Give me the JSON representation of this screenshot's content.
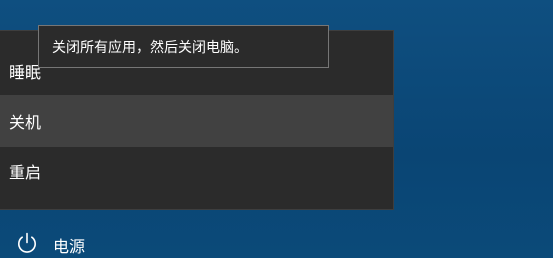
{
  "tooltip": {
    "text": "关闭所有应用，然后关闭电脑。"
  },
  "power_menu": {
    "items": [
      {
        "label": "睡眠"
      },
      {
        "label": "关机"
      },
      {
        "label": "重启"
      }
    ]
  },
  "power_button": {
    "label": "电源",
    "icon": "power-icon"
  },
  "colors": {
    "desktop_background": "#0d4a78",
    "menu_background": "#2b2b2b",
    "menu_hover": "#414141",
    "tooltip_border": "#767676"
  }
}
